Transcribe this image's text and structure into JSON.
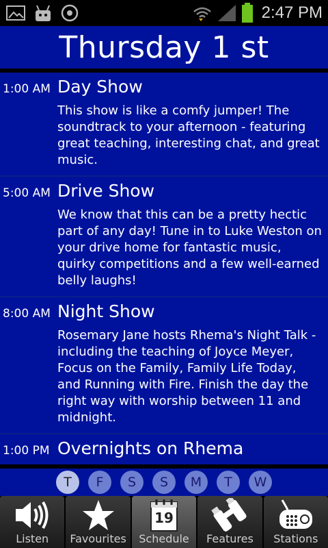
{
  "status_bar": {
    "time": "2:47 PM",
    "icons": [
      "gallery-icon",
      "android-icon",
      "sync-icon",
      "wifi-icon",
      "signal-icon",
      "battery-icon"
    ]
  },
  "header": {
    "title": "Thursday 1 st"
  },
  "schedule": [
    {
      "time": "1:00 AM",
      "title": "Day Show",
      "description": "This show is like a comfy jumper! The soundtrack to your afternoon - featuring great teaching, interesting chat, and great music."
    },
    {
      "time": "5:00 AM",
      "title": "Drive Show",
      "description": "We know that this can be a pretty hectic part of any day! Tune in to Luke Weston on your drive home for fantastic music, quirky competitions and a few well-earned belly laughs!"
    },
    {
      "time": "8:00 AM",
      "title": "Night Show",
      "description": "Rosemary Jane hosts Rhema's Night Talk - including the teaching of Joyce Meyer, Focus on the Family, Family Life Today, and Running with Fire. Finish the day the right way with worship between 11 and midnight."
    },
    {
      "time": "1:00 PM",
      "title": "Overnights on Rhema",
      "description": ""
    }
  ],
  "days": [
    {
      "label": "T",
      "active": true
    },
    {
      "label": "F",
      "active": false
    },
    {
      "label": "S",
      "active": false
    },
    {
      "label": "S",
      "active": false
    },
    {
      "label": "M",
      "active": false
    },
    {
      "label": "T",
      "active": false
    },
    {
      "label": "W",
      "active": false
    }
  ],
  "tabs": [
    {
      "label": "Listen",
      "icon": "speaker-icon",
      "active": false
    },
    {
      "label": "Favourites",
      "icon": "star-icon",
      "active": false
    },
    {
      "label": "Schedule",
      "icon": "calendar-icon",
      "calendar_day": "19",
      "active": true
    },
    {
      "label": "Features",
      "icon": "binoculars-icon",
      "active": false
    },
    {
      "label": "Stations",
      "icon": "radio-icon",
      "active": false
    }
  ],
  "colors": {
    "background_blue": "#00129c",
    "day_active": "#b9c2e9",
    "day_inactive": "#6d7fd0"
  }
}
